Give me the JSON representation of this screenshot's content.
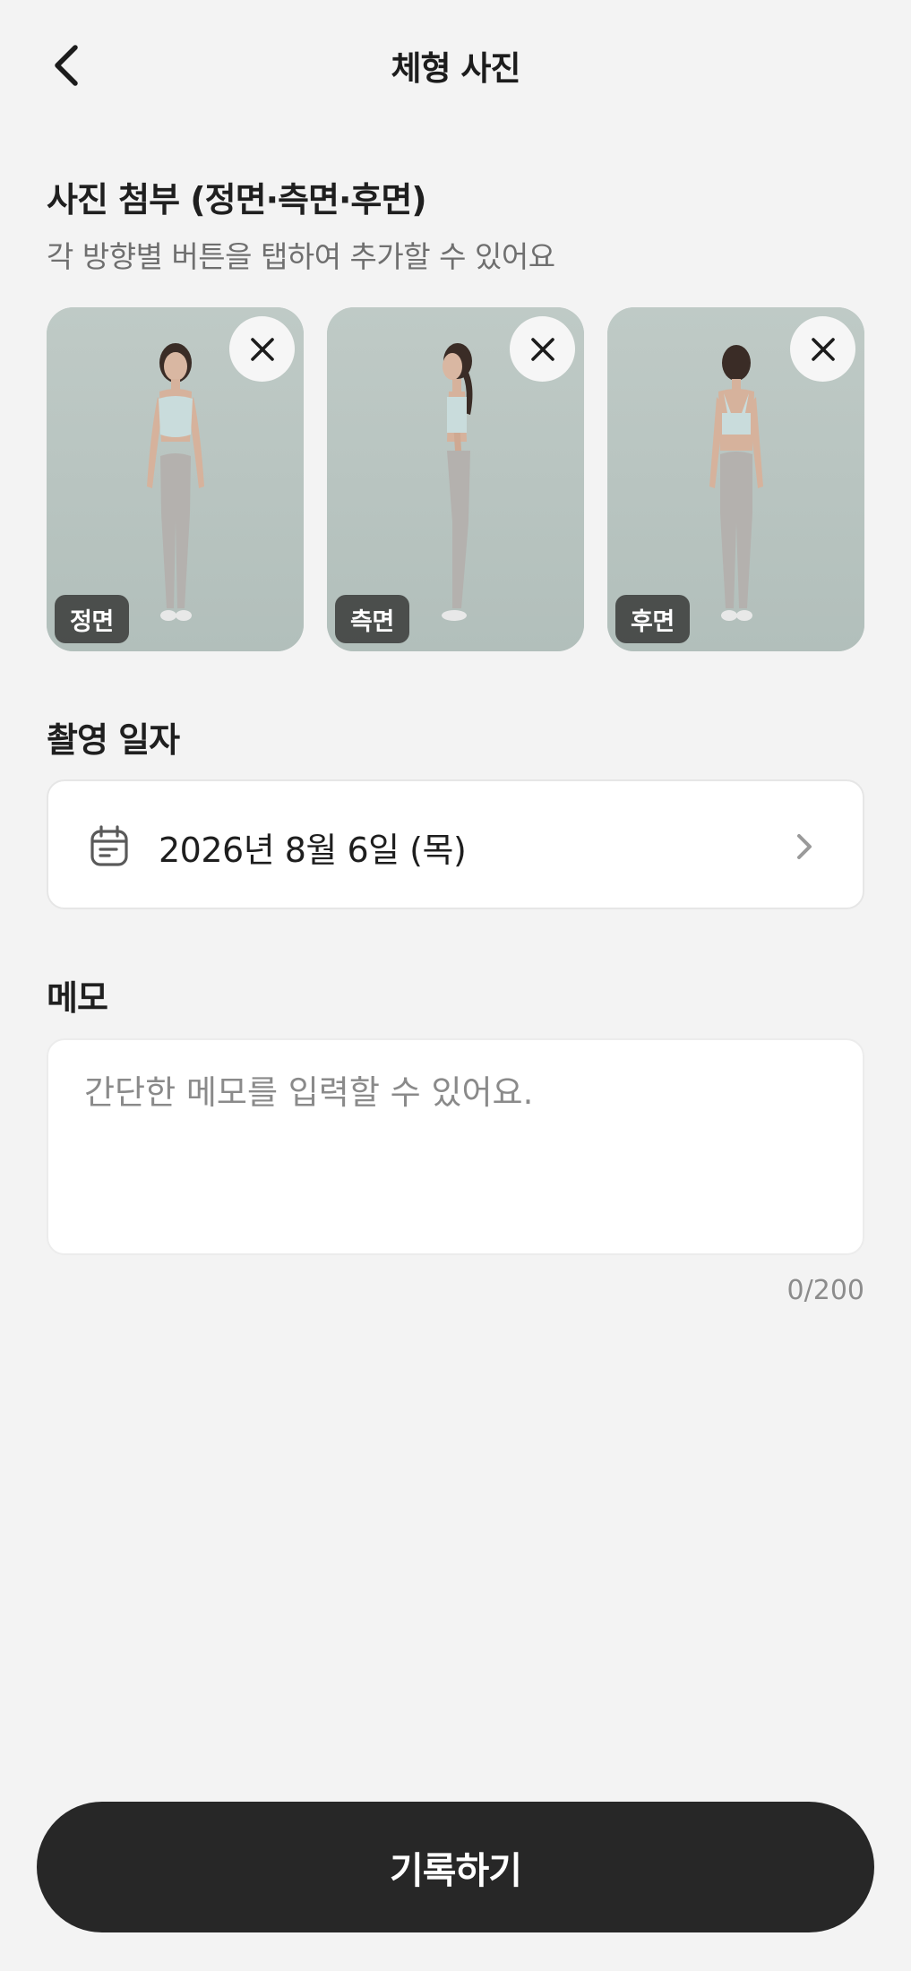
{
  "header": {
    "title": "체형 사진",
    "back_icon": "chevron-left-icon"
  },
  "photo_section": {
    "title": "사진 첨부 (정면·측면·후면)",
    "subtitle": "각 방향별 버튼을 탭하여 추가할 수 있어요",
    "photos": [
      {
        "label": "정면",
        "view": "front"
      },
      {
        "label": "측면",
        "view": "side"
      },
      {
        "label": "후면",
        "view": "back"
      }
    ],
    "remove_icon": "close-icon"
  },
  "date_section": {
    "title": "촬영 일자",
    "value": "2026년 8월 6일 (목)",
    "icon": "calendar-icon",
    "chevron": "chevron-right-icon"
  },
  "memo_section": {
    "title": "메모",
    "placeholder": "간단한 메모를 입력할 수 있어요.",
    "value": "",
    "counter": "0/200"
  },
  "submit": {
    "label": "기록하기"
  },
  "colors": {
    "background": "#f3f3f3",
    "primary_button": "#272727",
    "photo_backdrop": "#b9c6c2",
    "outfit_top": "#c9dcdc",
    "outfit_bottom": "#b4b1ae"
  }
}
